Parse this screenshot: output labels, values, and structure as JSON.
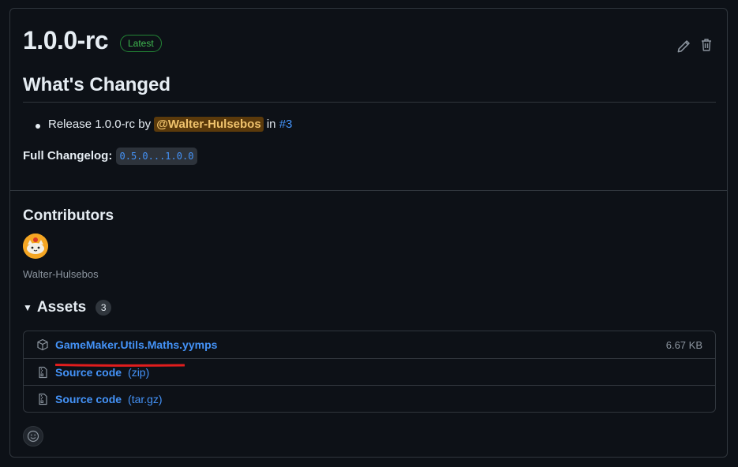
{
  "release": {
    "tag": "1.0.0-rc",
    "latest_badge": "Latest"
  },
  "notes": {
    "heading": "What's Changed",
    "item": {
      "prefix": "Release 1.0.0-rc by",
      "mention": "@Walter-Hulsebos",
      "in": "in",
      "pr": "#3"
    },
    "changelog_label": "Full Changelog:",
    "changelog_range": "0.5.0...1.0.0"
  },
  "contributors": {
    "heading": "Contributors",
    "names": [
      "Walter-Hulsebos"
    ]
  },
  "assets": {
    "heading": "Assets",
    "count": "3",
    "items": [
      {
        "name": "GameMaker.Utils.Maths.yymps",
        "ext": "",
        "size": "6.67 KB",
        "icon": "package-icon"
      },
      {
        "name": "Source code",
        "ext": "(zip)",
        "size": "",
        "icon": "file-zip-icon"
      },
      {
        "name": "Source code",
        "ext": "(tar.gz)",
        "size": "",
        "icon": "file-zip-icon"
      }
    ]
  },
  "colors": {
    "background": "#0d1117",
    "border": "#30363d",
    "link": "#4493f8",
    "latest_green": "#3fb950",
    "annotation_red": "#e11d1d"
  }
}
